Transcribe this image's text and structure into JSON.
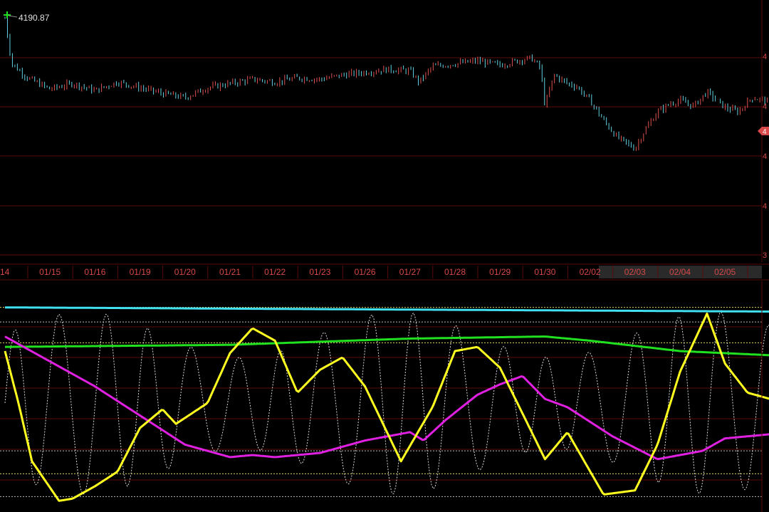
{
  "price_label": "4190.87",
  "colors": {
    "background": "#000000",
    "grid": "#5a0a0a",
    "axis_text": "#d84848",
    "candle_up": "#e05050",
    "candle_down": "#5fd0e0",
    "marker": "#20e020",
    "cyan_line": "#40e0f0",
    "green_line": "#20e020",
    "magenta_line": "#e020e0",
    "yellow_line": "#ffff20",
    "white_dotted": "#d8d8d8",
    "highlight_box": "#2a2a2a"
  },
  "chart_data": [
    {
      "type": "line",
      "name": "price-panel",
      "categories": [
        "14",
        "01/15",
        "01/16",
        "01/19",
        "01/20",
        "01/21",
        "01/22",
        "01/23",
        "01/26",
        "01/27",
        "01/28",
        "01/29",
        "01/30",
        "02/02",
        "02/03",
        "02/04",
        "02/05"
      ],
      "highlighted_category": "02/03",
      "annotation": "4190.87",
      "close": [
        [
          0,
          4192
        ],
        [
          0.15,
          4160
        ],
        [
          0.5,
          4150
        ],
        [
          1,
          4142
        ],
        [
          1.5,
          4146
        ],
        [
          2,
          4141
        ],
        [
          2.5,
          4147
        ],
        [
          3,
          4143
        ],
        [
          3.5,
          4139
        ],
        [
          4,
          4136
        ],
        [
          4.5,
          4143
        ],
        [
          5,
          4146
        ],
        [
          5.5,
          4149
        ],
        [
          6,
          4147
        ],
        [
          6.5,
          4150
        ],
        [
          7,
          4149
        ],
        [
          7.5,
          4152
        ],
        [
          8,
          4154
        ],
        [
          8.5,
          4156
        ],
        [
          9,
          4155
        ],
        [
          9.2,
          4147
        ],
        [
          9.5,
          4158
        ],
        [
          10,
          4160
        ],
        [
          10.5,
          4162
        ],
        [
          11,
          4159
        ],
        [
          11.5,
          4163
        ],
        [
          11.7,
          4164
        ],
        [
          11.9,
          4157
        ],
        [
          12,
          4130
        ],
        [
          12.2,
          4152
        ],
        [
          12.5,
          4146
        ],
        [
          12.7,
          4144
        ],
        [
          13,
          4134
        ],
        [
          13.3,
          4120
        ],
        [
          13.6,
          4108
        ],
        [
          14,
          4100
        ],
        [
          14.2,
          4112
        ],
        [
          14.5,
          4126
        ],
        [
          14.8,
          4132
        ],
        [
          15,
          4134
        ],
        [
          15.3,
          4130
        ],
        [
          15.6,
          4140
        ],
        [
          16,
          4129
        ],
        [
          16.3,
          4126
        ],
        [
          16.6,
          4136
        ],
        [
          16.9,
          4134
        ],
        [
          17,
          4132
        ]
      ],
      "ylim": [
        4060,
        4195
      ]
    },
    {
      "type": "line",
      "name": "oscillator-panel",
      "ylim": [
        0,
        100
      ],
      "series": [
        {
          "id": "cyan",
          "values": [
            [
              0,
              96
            ],
            [
              17,
              94
            ]
          ]
        },
        {
          "id": "green",
          "values": [
            [
              0,
              77
            ],
            [
              5,
              78
            ],
            [
              9,
              81
            ],
            [
              12,
              82
            ],
            [
              13,
              80
            ],
            [
              15,
              75
            ],
            [
              17,
              73
            ]
          ]
        },
        {
          "id": "magenta",
          "values": [
            [
              0,
              82
            ],
            [
              1,
              70
            ],
            [
              2,
              58
            ],
            [
              3,
              44
            ],
            [
              4,
              30
            ],
            [
              5,
              24
            ],
            [
              5.5,
              25
            ],
            [
              6,
              24
            ],
            [
              7,
              26
            ],
            [
              8,
              32
            ],
            [
              9,
              36
            ],
            [
              9.3,
              32
            ],
            [
              9.8,
              42
            ],
            [
              10.5,
              54
            ],
            [
              11,
              59
            ],
            [
              11.5,
              63
            ],
            [
              12,
              52
            ],
            [
              12.5,
              48
            ],
            [
              13.5,
              34
            ],
            [
              14.5,
              23
            ],
            [
              15.5,
              27
            ],
            [
              16,
              33
            ],
            [
              17,
              35
            ]
          ]
        },
        {
          "id": "yellow",
          "values": [
            [
              0,
              75
            ],
            [
              0.3,
              50
            ],
            [
              0.6,
              22
            ],
            [
              1.2,
              3
            ],
            [
              1.5,
              4
            ],
            [
              2,
              10
            ],
            [
              2.5,
              17
            ],
            [
              3,
              38
            ],
            [
              3.5,
              47
            ],
            [
              3.8,
              40
            ],
            [
              4.5,
              50
            ],
            [
              5,
              74
            ],
            [
              5.5,
              86
            ],
            [
              6,
              80
            ],
            [
              6.5,
              55
            ],
            [
              7,
              66
            ],
            [
              7.5,
              72
            ],
            [
              8,
              58
            ],
            [
              8.8,
              22
            ],
            [
              9.5,
              48
            ],
            [
              10,
              75
            ],
            [
              10.5,
              77
            ],
            [
              11,
              67
            ],
            [
              11.5,
              45
            ],
            [
              12,
              23
            ],
            [
              12.5,
              36
            ],
            [
              13.3,
              6
            ],
            [
              14,
              8
            ],
            [
              14.5,
              30
            ],
            [
              15,
              65
            ],
            [
              15.6,
              93
            ],
            [
              16,
              69
            ],
            [
              16.5,
              55
            ],
            [
              17,
              52
            ]
          ]
        }
      ],
      "reference_levels": [
        96,
        89,
        79,
        27,
        16,
        5
      ]
    }
  ]
}
